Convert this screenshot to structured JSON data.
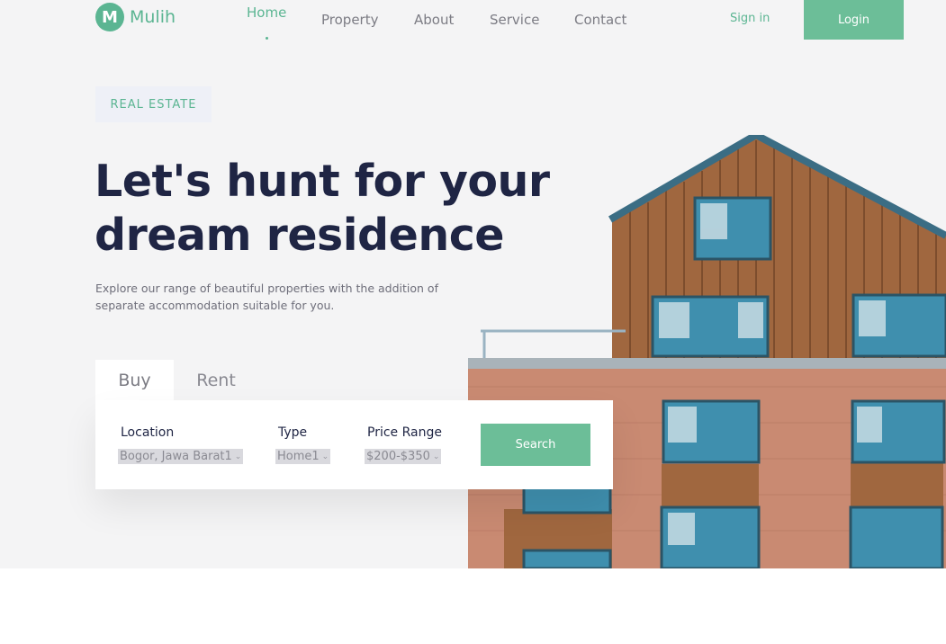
{
  "brand": {
    "logo_letter": "M",
    "name": "Mulih",
    "color": "#5bb592"
  },
  "nav": {
    "items": [
      {
        "label": "Home",
        "active": true
      },
      {
        "label": "Property",
        "active": false
      },
      {
        "label": "About",
        "active": false
      },
      {
        "label": "Service",
        "active": false
      },
      {
        "label": "Contact",
        "active": false
      }
    ],
    "signin_label": "Sign in",
    "login_label": "Login"
  },
  "hero": {
    "badge": "REAL ESTATE",
    "headline": "Let's hunt for your dream residence",
    "subtitle": "Explore our range of beautiful properties with the addition of separate accommodation suitable for you.",
    "image_icon": "apartment-building-image"
  },
  "search": {
    "tabs": [
      {
        "label": "Buy",
        "active": true
      },
      {
        "label": "Rent",
        "active": false
      }
    ],
    "fields": [
      {
        "label": "Location",
        "value": "Bogor, Jawa Barat1"
      },
      {
        "label": "Type",
        "value": "Home1"
      },
      {
        "label": "Price Range",
        "value": "$200-$350"
      }
    ],
    "button_label": "Search"
  },
  "colors": {
    "accent": "#6cbe98",
    "heading": "#1f2544",
    "background": "#f4f4f5"
  }
}
